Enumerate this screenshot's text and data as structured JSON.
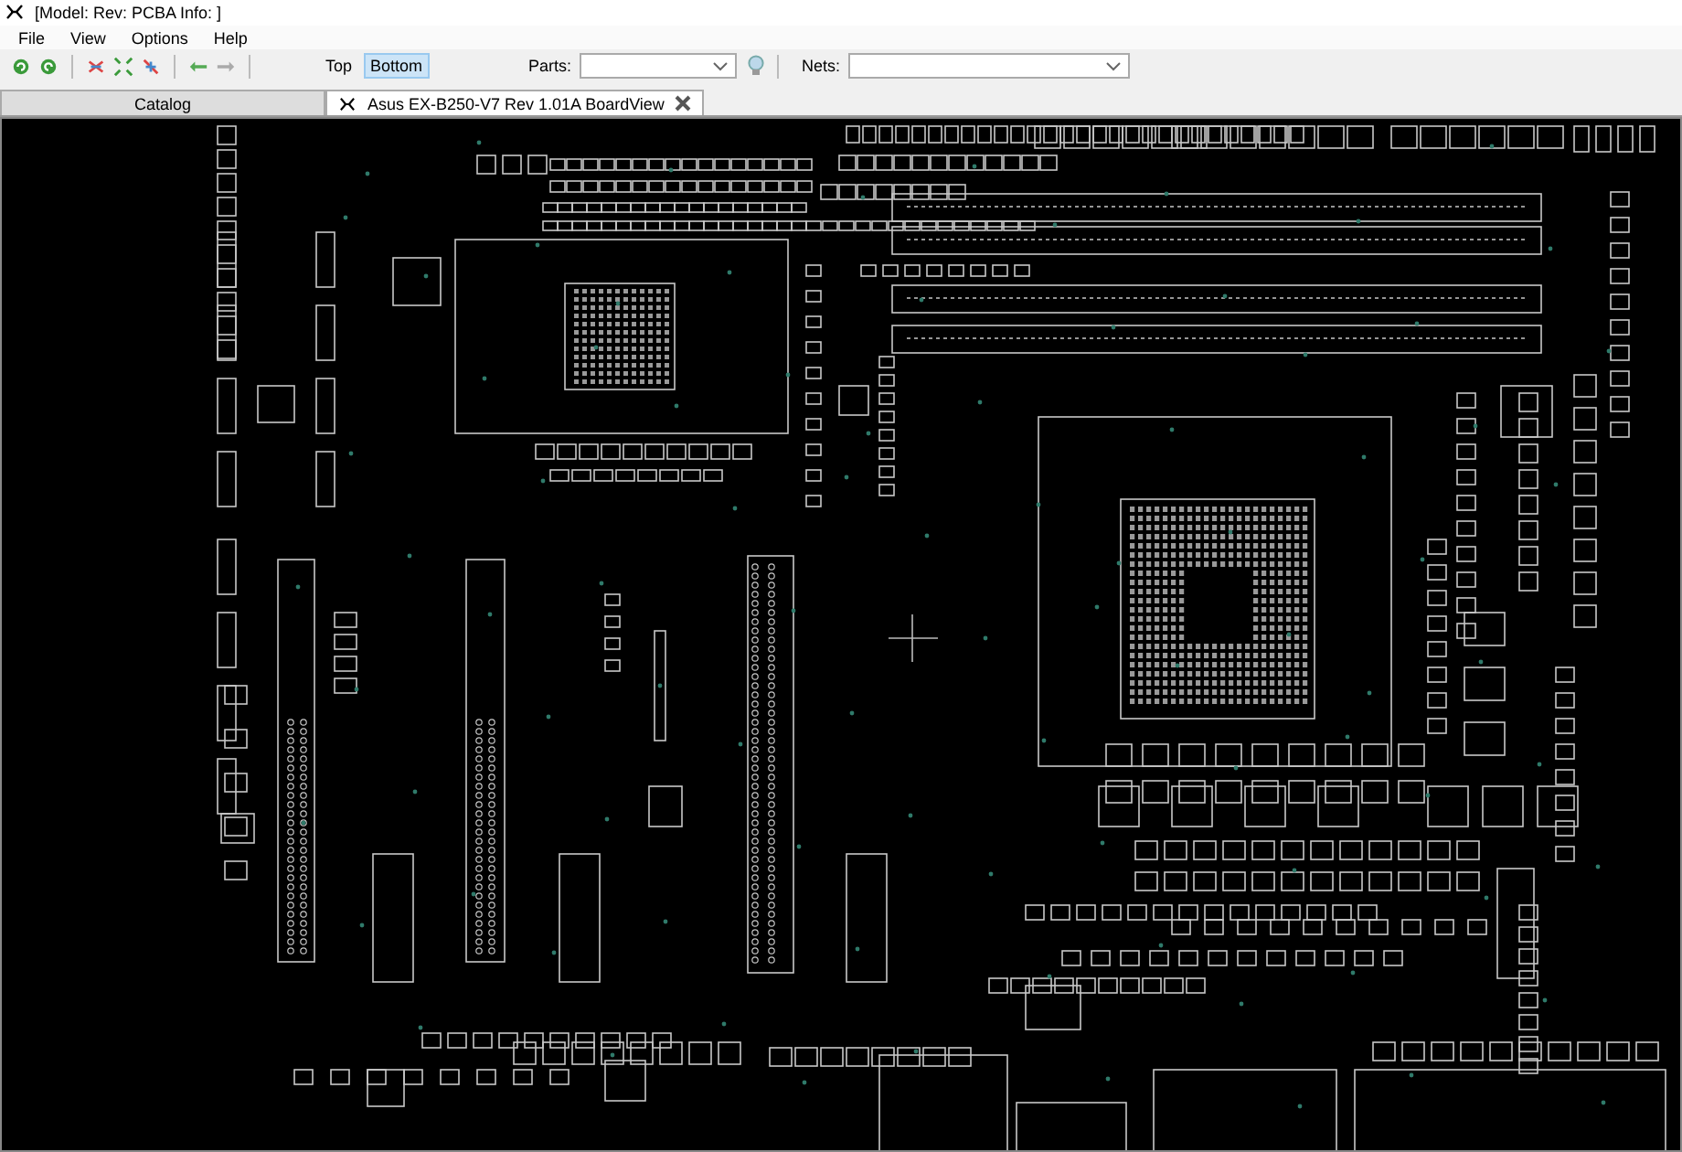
{
  "window": {
    "title": "[Model: Rev:  PCBA Info: ]"
  },
  "menu": [
    "File",
    "View",
    "Options",
    "Help"
  ],
  "layers": [
    {
      "label": "Top",
      "selected": false
    },
    {
      "label": "Bottom",
      "selected": true
    }
  ],
  "parts": {
    "label": "Parts:"
  },
  "nets": {
    "label": "Nets:"
  },
  "tabs": [
    {
      "label": "Catalog",
      "selected": false,
      "kind": "catalog"
    },
    {
      "label": "Asus EX-B250-V7 Rev 1.01A BoardView",
      "selected": true,
      "kind": "document"
    }
  ]
}
